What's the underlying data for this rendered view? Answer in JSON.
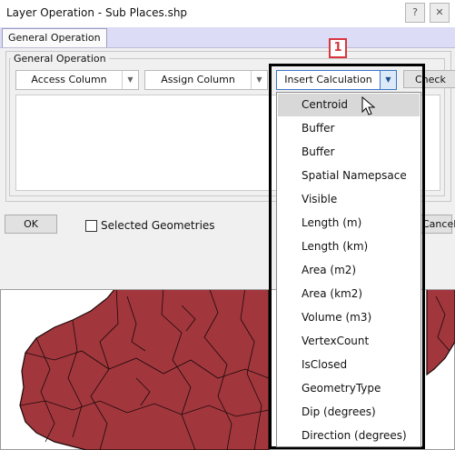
{
  "window": {
    "title": "Layer Operation - Sub Places.shp"
  },
  "tabs": [
    {
      "label": "General Operation"
    }
  ],
  "group": {
    "label": "General Operation"
  },
  "toolbar": {
    "access_column": "Access Column",
    "assign_column": "Assign Column",
    "insert_calculation": "Insert Calculation",
    "check_label": "Check"
  },
  "footer": {
    "ok_label": "OK",
    "selected_geometries_label": "Selected Geometries",
    "selected_geometries_checked": false,
    "cancel_label": "Cancel"
  },
  "annotation": {
    "badge": "1"
  },
  "dropdown": {
    "selected_index": 0,
    "items": [
      "Centroid",
      "Buffer",
      "Buffer",
      "Spatial Namepsace",
      "Visible",
      "Length (m)",
      "Length (km)",
      "Area (m2)",
      "Area (km2)",
      "Volume (m3)",
      "VertexCount",
      "IsClosed",
      "GeometryType",
      "Dip (degrees)",
      "Direction (degrees)"
    ]
  },
  "colors": {
    "map_fill": "#a1373d",
    "map_stroke": "#1b0808",
    "annotation": "#d9363e",
    "tab_strip": "#dcdcf7"
  }
}
